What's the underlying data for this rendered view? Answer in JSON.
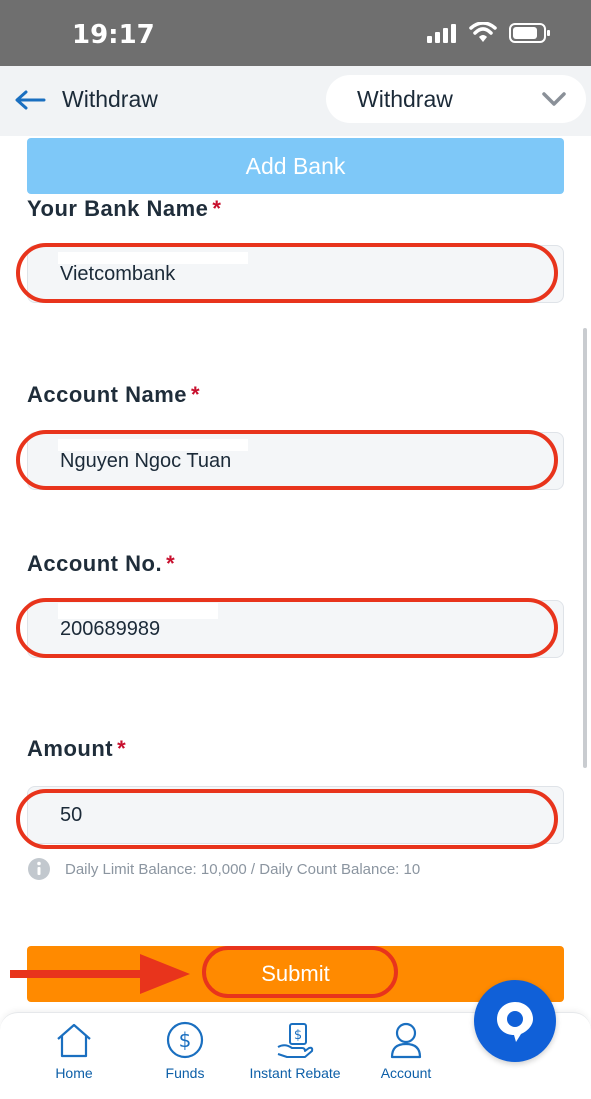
{
  "status_bar": {
    "time": "19:17"
  },
  "header": {
    "title": "Withdraw",
    "select_value": "Withdraw"
  },
  "add_bank_label": "Add Bank",
  "form": {
    "bank_name": {
      "label": "Your Bank Name",
      "required_mark": "*",
      "value": "Vietcombank"
    },
    "account_name": {
      "label": "Account Name",
      "required_mark": "*",
      "value": "Nguyen Ngoc Tuan"
    },
    "account_no": {
      "label": "Account No.",
      "required_mark": "*",
      "value": "200689989"
    },
    "amount": {
      "label": "Amount",
      "required_mark": "*",
      "value": "50"
    },
    "hint": "Daily Limit Balance: 10,000 / Daily Count Balance: 10"
  },
  "submit_label": "Submit",
  "bottom_nav": [
    {
      "label": "Home",
      "icon": "home-icon"
    },
    {
      "label": "Funds",
      "icon": "dollar-icon"
    },
    {
      "label": "Instant Rebate",
      "icon": "rebate-icon"
    },
    {
      "label": "Account",
      "icon": "user-icon"
    }
  ],
  "colors": {
    "accent_blue": "#1060d8",
    "add_bank_bg": "#7ec8f8",
    "submit_bg": "#ff8a00",
    "highlight_red": "#e8341c",
    "required_red": "#c8102e"
  }
}
